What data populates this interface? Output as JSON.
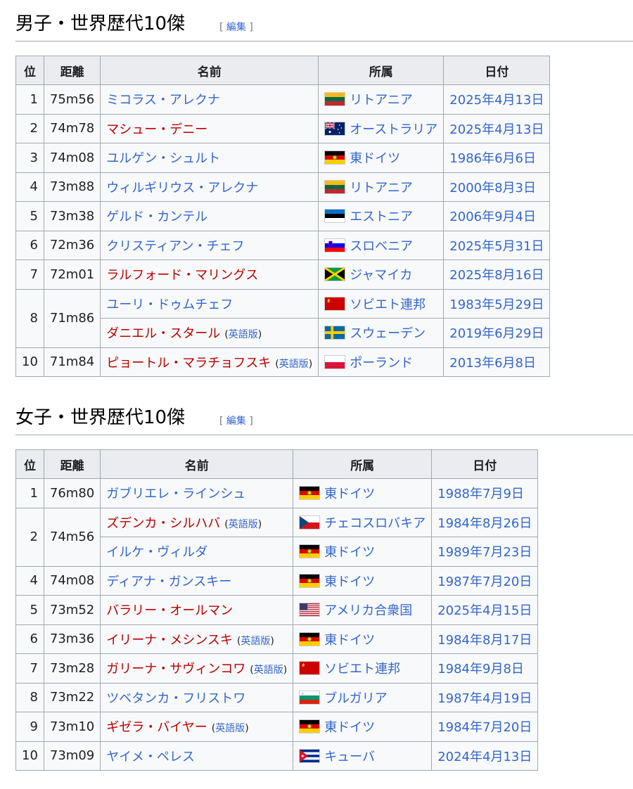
{
  "men": {
    "heading": "男子・世界歴代10傑",
    "edit_open": "[",
    "edit_label": "編集",
    "edit_close": "]",
    "headers": [
      "位",
      "距離",
      "名前",
      "所属",
      "日付"
    ],
    "rows": [
      {
        "rank": "1",
        "mark": "75m56",
        "name": "ミコラス・アレクナ",
        "name_red": false,
        "en": "",
        "flag": "lithuania-flag",
        "country": "リトアニア",
        "date": "2025年4月13日"
      },
      {
        "rank": "2",
        "mark": "74m78",
        "name": "マシュー・デニー",
        "name_red": true,
        "en": "",
        "flag": "australia-flag",
        "country": "オーストラリア",
        "date": "2025年4月13日"
      },
      {
        "rank": "3",
        "mark": "74m08",
        "name": "ユルゲン・シュルト",
        "name_red": false,
        "en": "",
        "flag": "east-germany-flag",
        "country": "東ドイツ",
        "date": "1986年6月6日"
      },
      {
        "rank": "4",
        "mark": "73m88",
        "name": "ウィルギリウス・アレクナ",
        "name_red": false,
        "en": "",
        "flag": "lithuania-flag",
        "country": "リトアニア",
        "date": "2000年8月3日"
      },
      {
        "rank": "5",
        "mark": "73m38",
        "name": "ゲルド・カンテル",
        "name_red": false,
        "en": "",
        "flag": "estonia-flag",
        "country": "エストニア",
        "date": "2006年9月4日"
      },
      {
        "rank": "6",
        "mark": "72m36",
        "name": "クリスティアン・チェフ",
        "name_red": false,
        "en": "",
        "flag": "slovenia-flag",
        "country": "スロベニア",
        "date": "2025年5月31日"
      },
      {
        "rank": "7",
        "mark": "72m01",
        "name": "ラルフォード・マリングス",
        "name_red": true,
        "en": "",
        "flag": "jamaica-flag",
        "country": "ジャマイカ",
        "date": "2025年8月16日"
      },
      {
        "rank": "8",
        "mark": "71m86",
        "name": "ユーリ・ドゥムチェフ",
        "name_red": false,
        "en": "",
        "flag": "soviet-union-flag",
        "country": "ソビエト連邦",
        "date": "1983年5月29日"
      },
      {
        "rank": "",
        "mark": "",
        "name": "ダニエル・スタール",
        "name_red": true,
        "en": "英語版",
        "flag": "sweden-flag",
        "country": "スウェーデン",
        "date": "2019年6月29日"
      },
      {
        "rank": "10",
        "mark": "71m84",
        "name": "ピョートル・マラチョフスキ",
        "name_red": true,
        "en": "英語版",
        "flag": "poland-flag",
        "country": "ポーランド",
        "date": "2013年6月8日"
      }
    ]
  },
  "women": {
    "heading": "女子・世界歴代10傑",
    "edit_open": "[",
    "edit_label": "編集",
    "edit_close": "]",
    "headers": [
      "位",
      "距離",
      "名前",
      "所属",
      "日付"
    ],
    "rows": [
      {
        "rank": "1",
        "mark": "76m80",
        "name": "ガブリエレ・ラインシュ",
        "name_red": false,
        "en": "",
        "flag": "east-germany-flag",
        "country": "東ドイツ",
        "date": "1988年7月9日"
      },
      {
        "rank": "2",
        "mark": "74m56",
        "name": "ズデンカ・シルハバ",
        "name_red": true,
        "en": "英語版",
        "flag": "czechoslovakia-flag",
        "country": "チェコスロバキア",
        "date": "1984年8月26日"
      },
      {
        "rank": "",
        "mark": "",
        "name": "イルケ・ヴィルダ",
        "name_red": false,
        "en": "",
        "flag": "east-germany-flag",
        "country": "東ドイツ",
        "date": "1989年7月23日"
      },
      {
        "rank": "4",
        "mark": "74m08",
        "name": "ディアナ・ガンスキー",
        "name_red": false,
        "en": "",
        "flag": "east-germany-flag",
        "country": "東ドイツ",
        "date": "1987年7月20日"
      },
      {
        "rank": "5",
        "mark": "73m52",
        "name": "バラリー・オールマン",
        "name_red": true,
        "en": "",
        "flag": "usa-flag",
        "country": "アメリカ合衆国",
        "date": "2025年4月15日"
      },
      {
        "rank": "6",
        "mark": "73m36",
        "name": "イリーナ・メシンスキ",
        "name_red": true,
        "en": "英語版",
        "flag": "east-germany-flag",
        "country": "東ドイツ",
        "date": "1984年8月17日"
      },
      {
        "rank": "7",
        "mark": "73m28",
        "name": "ガリーナ・サヴィンコワ",
        "name_red": true,
        "en": "英語版",
        "flag": "soviet-union-flag",
        "country": "ソビエト連邦",
        "date": "1984年9月8日"
      },
      {
        "rank": "8",
        "mark": "73m22",
        "name": "ツベタンカ・フリストワ",
        "name_red": false,
        "en": "",
        "flag": "bulgaria-flag",
        "country": "ブルガリア",
        "date": "1987年4月19日"
      },
      {
        "rank": "9",
        "mark": "73m10",
        "name": "ギゼラ・バイヤー",
        "name_red": true,
        "en": "英語版",
        "flag": "east-germany-flag",
        "country": "東ドイツ",
        "date": "1984年7月20日"
      },
      {
        "rank": "10",
        "mark": "73m09",
        "name": "ヤイメ・ペレス",
        "name_red": false,
        "en": "",
        "flag": "cuba-flag",
        "country": "キューバ",
        "date": "2024年4月13日"
      }
    ]
  },
  "colors": {
    "link": "#3366cc",
    "redlink": "#ba0000",
    "header_bg": "#eaecf0",
    "cell_bg": "#f8f9fa",
    "border": "#a2a9b1"
  }
}
